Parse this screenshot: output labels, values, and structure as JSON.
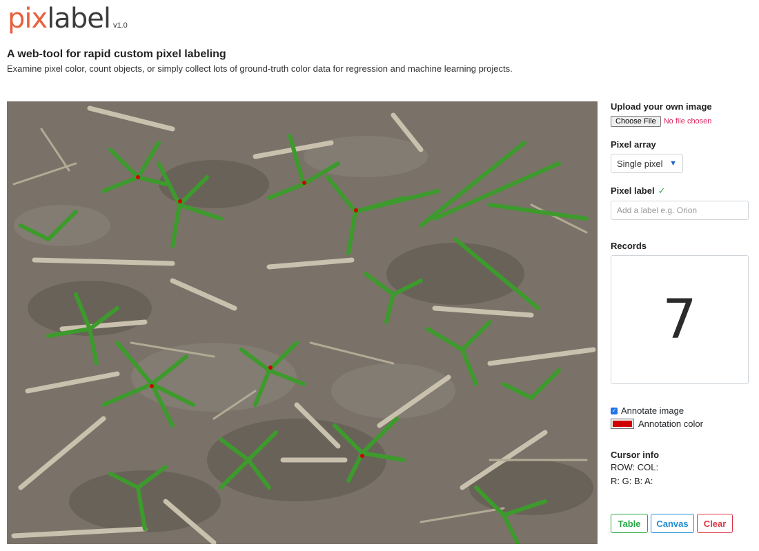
{
  "header": {
    "logo_pix": "pix",
    "logo_label": "label",
    "version": "v1.0",
    "tagline": "A web-tool for rapid custom pixel labeling",
    "subtagline": "Examine pixel color, count objects, or simply collect lots of ground-truth color data for regression and machine learning projects."
  },
  "upload": {
    "title": "Upload your own image",
    "button": "Choose File",
    "status": "No file chosen"
  },
  "pixel_array": {
    "title": "Pixel array",
    "selected": "Single pixel"
  },
  "pixel_label": {
    "title": "Pixel label",
    "check": "✓",
    "placeholder": "Add a label e.g. Orion"
  },
  "records": {
    "title": "Records",
    "count": "7"
  },
  "annotate": {
    "checkbox_label": "Annotate image",
    "checked": true,
    "color_label": "Annotation color",
    "color": "#d00000"
  },
  "cursor": {
    "title": "Cursor info",
    "rowcol": "ROW: COL:",
    "rgba": "R: G: B: A:"
  },
  "buttons": {
    "table": "Table",
    "canvas": "Canvas",
    "clear": "Clear"
  },
  "image": {
    "description_icon": "field-photo",
    "marker_count": 7
  },
  "colors": {
    "accent": "#e8613c",
    "success": "#28a745",
    "info": "#1f8dd6",
    "danger": "#dc3545"
  }
}
